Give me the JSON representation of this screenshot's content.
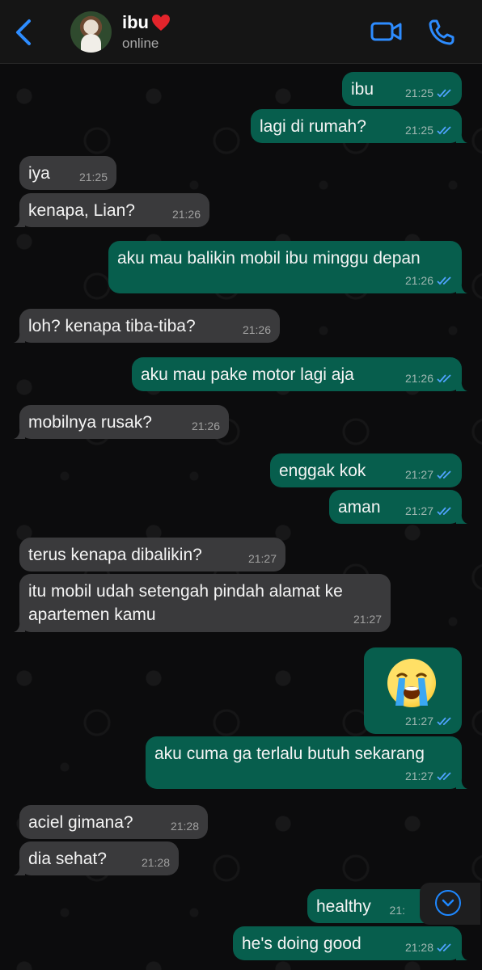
{
  "header": {
    "contact_name": "ibu",
    "heart_icon": "red-heart",
    "status": "online"
  },
  "colors": {
    "incoming_bubble": "#3a3a3c",
    "outgoing_bubble": "#075e4d",
    "read_ticks": "#4fa3ff",
    "accent": "#1e88ff"
  },
  "messages": [
    {
      "dir": "out",
      "text": "ibu",
      "time": "21:25",
      "read": true
    },
    {
      "dir": "out",
      "text": "lagi di rumah?",
      "time": "21:25",
      "read": true
    },
    {
      "dir": "in",
      "text": "iya",
      "time": "21:25"
    },
    {
      "dir": "in",
      "text": "kenapa, Lian?",
      "time": "21:26"
    },
    {
      "dir": "out",
      "text": "aku mau balikin mobil ibu minggu depan",
      "time": "21:26",
      "read": true
    },
    {
      "dir": "in",
      "text": "loh? kenapa tiba-tiba?",
      "time": "21:26"
    },
    {
      "dir": "out",
      "text": "aku mau pake motor lagi aja",
      "time": "21:26",
      "read": true
    },
    {
      "dir": "in",
      "text": "mobilnya rusak?",
      "time": "21:26"
    },
    {
      "dir": "out",
      "text": "enggak kok",
      "time": "21:27",
      "read": true
    },
    {
      "dir": "out",
      "text": "aman",
      "time": "21:27",
      "read": true
    },
    {
      "dir": "in",
      "text": "terus kenapa dibalikin?",
      "time": "21:27"
    },
    {
      "dir": "in",
      "text": "itu mobil udah setengah pindah alamat ke apartemen kamu",
      "time": "21:27"
    },
    {
      "dir": "out",
      "text": "",
      "emoji": "loudly-crying-face",
      "time": "21:27",
      "read": true
    },
    {
      "dir": "out",
      "text": "aku cuma ga terlalu butuh sekarang",
      "time": "21:27",
      "read": true
    },
    {
      "dir": "in",
      "text": "aciel gimana?",
      "time": "21:28"
    },
    {
      "dir": "in",
      "text": "dia sehat?",
      "time": "21:28"
    },
    {
      "dir": "out",
      "text": "healthy",
      "time": "21:",
      "read": true
    },
    {
      "dir": "out",
      "text": "he's doing good",
      "time": "21:28",
      "read": true
    }
  ]
}
